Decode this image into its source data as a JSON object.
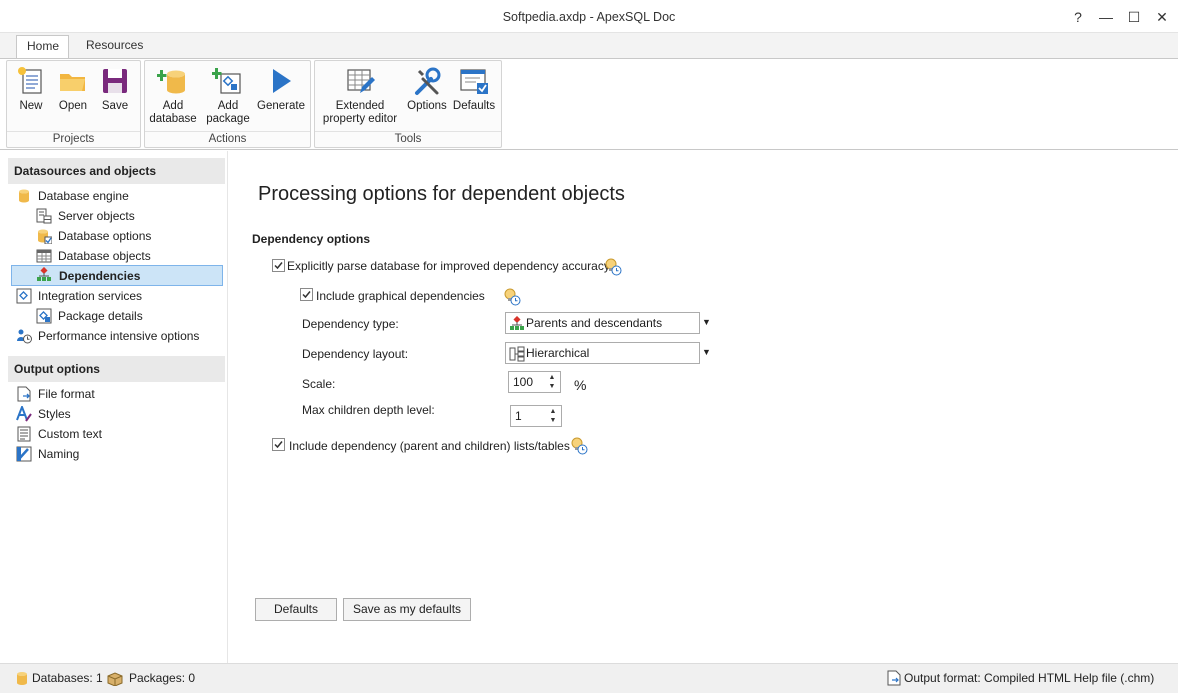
{
  "window": {
    "title": "Softpedia.axdp - ApexSQL Doc",
    "help_glyph": "?",
    "min_glyph": "—",
    "max_glyph": "☐",
    "close_glyph": "✕"
  },
  "tabs": [
    {
      "label": "Home",
      "active": true
    },
    {
      "label": "Resources",
      "active": false
    }
  ],
  "ribbon": {
    "groups": [
      {
        "title": "Projects",
        "buttons": [
          {
            "label": "New",
            "icon": "new-project-icon"
          },
          {
            "label": "Open",
            "icon": "folder-icon"
          },
          {
            "label": "Save",
            "icon": "floppy-disk-icon"
          }
        ]
      },
      {
        "title": "Actions",
        "buttons": [
          {
            "label": "Add\ndatabase",
            "icon": "add-database-icon"
          },
          {
            "label": "Add\npackage",
            "icon": "add-package-icon"
          },
          {
            "label": "Generate",
            "icon": "play-arrow-icon"
          }
        ]
      },
      {
        "title": "Tools",
        "buttons": [
          {
            "label": "Extended\nproperty editor",
            "icon": "grid-pencil-icon"
          },
          {
            "label": "Options",
            "icon": "wrench-screwdriver-icon"
          },
          {
            "label": "Defaults",
            "icon": "window-check-icon"
          }
        ]
      }
    ]
  },
  "sidebar": {
    "sections": [
      {
        "title": "Datasources and objects",
        "items": [
          {
            "label": "Database engine",
            "icon": "database-icon",
            "level": 0,
            "selected": false
          },
          {
            "label": "Server objects",
            "icon": "server-objects-icon",
            "level": 1,
            "selected": false
          },
          {
            "label": "Database options",
            "icon": "database-options-icon",
            "level": 1,
            "selected": false
          },
          {
            "label": "Database objects",
            "icon": "table-icon",
            "level": 1,
            "selected": false
          },
          {
            "label": "Dependencies",
            "icon": "hierarchy-icon",
            "level": 1,
            "selected": true
          },
          {
            "label": "Integration services",
            "icon": "integration-services-icon",
            "level": 0,
            "selected": false
          },
          {
            "label": "Package details",
            "icon": "package-details-icon",
            "level": 1,
            "selected": false
          },
          {
            "label": "Performance intensive options",
            "icon": "users-clock-icon",
            "level": 0,
            "selected": false
          }
        ]
      },
      {
        "title": "Output options",
        "items": [
          {
            "label": "File format",
            "icon": "file-format-icon",
            "level": 0,
            "selected": false
          },
          {
            "label": "Styles",
            "icon": "styles-icon",
            "level": 0,
            "selected": false
          },
          {
            "label": "Custom text",
            "icon": "document-text-icon",
            "level": 0,
            "selected": false
          },
          {
            "label": "Naming",
            "icon": "naming-icon",
            "level": 0,
            "selected": false
          }
        ]
      }
    ]
  },
  "main": {
    "heading": "Processing options for dependent objects",
    "group_title": "Dependency options",
    "explicit_parse": {
      "label": "Explicitly parse database for improved dependency accuracy",
      "checked": true
    },
    "include_graphical": {
      "label": "Include graphical dependencies",
      "checked": true
    },
    "dependency_type": {
      "label": "Dependency type:",
      "value": "Parents and descendants"
    },
    "dependency_layout": {
      "label": "Dependency layout:",
      "value": "Hierarchical"
    },
    "scale": {
      "label": "Scale:",
      "value": "100",
      "unit": "%"
    },
    "max_depth": {
      "label": "Max children depth level:",
      "value": "1"
    },
    "include_lists": {
      "label": "Include dependency (parent and children) lists/tables",
      "checked": true
    },
    "defaults_button": "Defaults",
    "save_defaults_button": "Save as my defaults"
  },
  "statusbar": {
    "databases": "Databases: 1",
    "packages": "Packages: 0",
    "output_format": "Output format: Compiled HTML Help file (.chm)"
  },
  "colors": {
    "selection_bg": "#cce4f7",
    "selection_border": "#7eb4ea",
    "accent_blue": "#2b74c7",
    "db_yellow": "#f0b94a"
  }
}
